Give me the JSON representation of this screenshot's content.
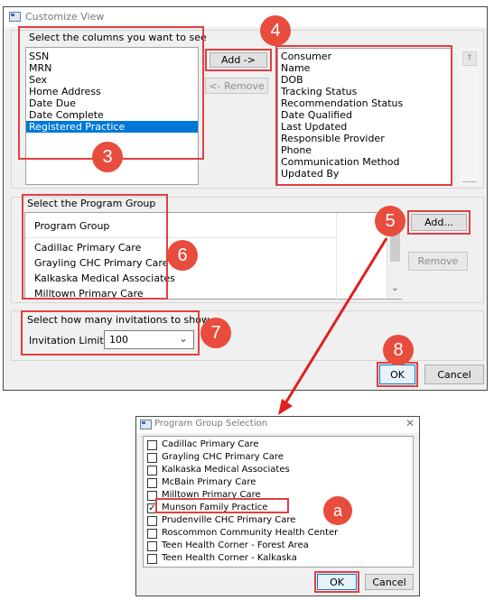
{
  "customize": {
    "title": "Customize View",
    "columns_group_label": "Select the columns you want to see",
    "available_columns": [
      "SSN",
      "MRN",
      "Sex",
      "Home Address",
      "Date Due",
      "Date Complete",
      "Registered Practice"
    ],
    "selected_available": "Registered Practice",
    "add_label": "Add ->",
    "remove_label": "<- Remove",
    "chosen_columns": [
      "Consumer",
      "Name",
      "DOB",
      "Tracking Status",
      "Recommendation Status",
      "Date Qualified",
      "Last Updated",
      "Responsible Provider",
      "Phone",
      "Communication Method",
      "Updated By"
    ],
    "program_group_label": "Select the Program Group",
    "program_header": "Program Group",
    "programs": [
      "Cadillac Primary Care",
      "Grayling CHC Primary Care",
      "Kalkaska Medical Associates",
      "Milltown Primary Care"
    ],
    "pg_add_label": "Add...",
    "pg_remove_label": "Remove",
    "invitations_group_label": "Select how many invitations to show",
    "invitation_limit_label": "Invitation Limit:",
    "invitation_limit_value": "100",
    "ok_label": "OK",
    "cancel_label": "Cancel"
  },
  "program_selection": {
    "title": "Program Group Selection",
    "items": [
      {
        "label": "Cadillac Primary Care",
        "checked": false
      },
      {
        "label": "Grayling CHC Primary Care",
        "checked": false
      },
      {
        "label": "Kalkaska Medical Associates",
        "checked": false
      },
      {
        "label": "McBain Primary Care",
        "checked": false
      },
      {
        "label": "Milltown Primary Care",
        "checked": false
      },
      {
        "label": "Munson Family Practice",
        "checked": true
      },
      {
        "label": "Prudenville CHC Primary Care",
        "checked": false
      },
      {
        "label": "Roscommon Community Health Center",
        "checked": false
      },
      {
        "label": "Teen Health Corner - Forest Area",
        "checked": false
      },
      {
        "label": "Teen Health Corner - Kalkaska",
        "checked": false
      }
    ],
    "ok_label": "OK",
    "cancel_label": "Cancel"
  },
  "badges": {
    "b3": "3",
    "b4": "4",
    "b5": "5",
    "b6": "6",
    "b7": "7",
    "b8": "8",
    "ba": "a"
  },
  "colors": {
    "highlight": "#e04040",
    "badge": "#e84c3d",
    "selection": "#0078d7"
  }
}
